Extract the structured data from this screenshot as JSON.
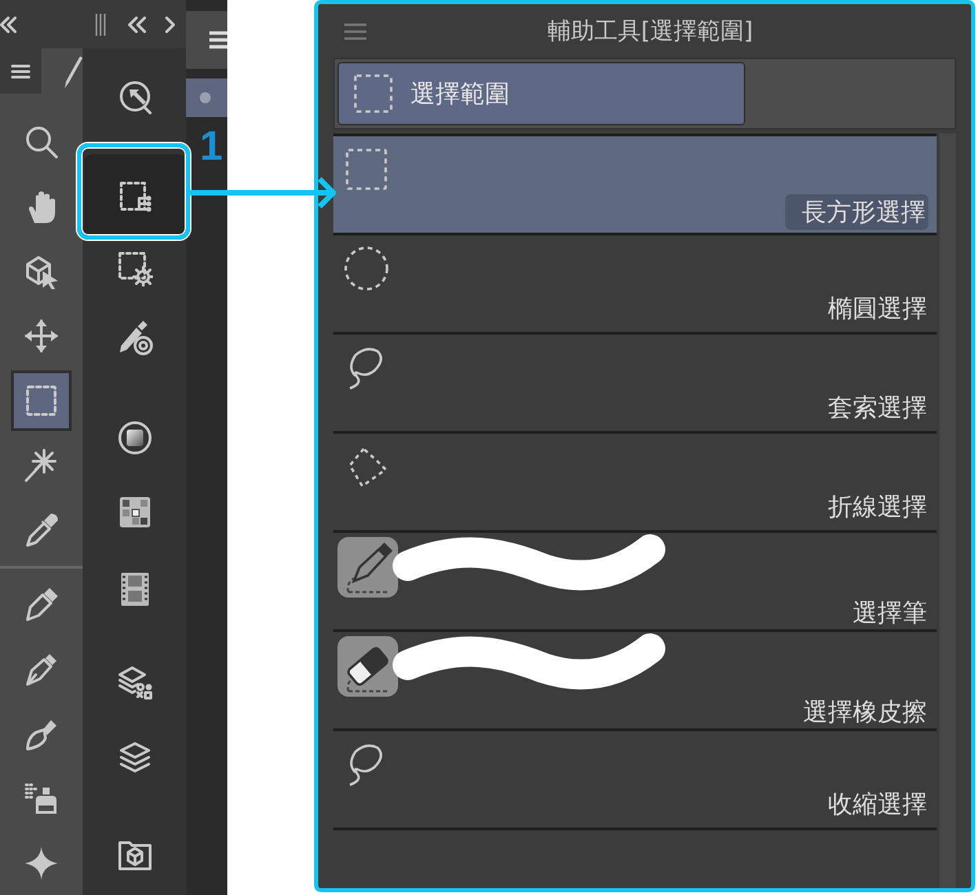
{
  "left_dock": {
    "tool_groups": [
      {
        "tools": [
          {
            "selected": false
          },
          {
            "selected": false
          },
          {
            "selected": false
          },
          {
            "selected": false
          },
          {
            "selected": true
          },
          {
            "selected": false
          },
          {
            "selected": false
          }
        ]
      },
      {
        "tools": [
          {
            "selected": false
          },
          {
            "selected": false
          },
          {
            "selected": false
          },
          {
            "selected": false
          },
          {
            "selected": false
          }
        ]
      }
    ]
  },
  "callout": {
    "number": "1"
  },
  "sub_tool_panel": {
    "title": "輔助工具[選擇範圍]",
    "groups": [
      {
        "label": "選擇範圍",
        "selected": true
      }
    ],
    "sub_tools": [
      {
        "label": "長方形選擇",
        "selected": true,
        "kind": "shape"
      },
      {
        "label": "橢圓選擇",
        "selected": false,
        "kind": "shape"
      },
      {
        "label": "套索選擇",
        "selected": false,
        "kind": "shape"
      },
      {
        "label": "折線選擇",
        "selected": false,
        "kind": "shape"
      },
      {
        "label": "選擇筆",
        "selected": false,
        "kind": "brush"
      },
      {
        "label": "選擇橡皮擦",
        "selected": false,
        "kind": "brush"
      },
      {
        "label": "收縮選擇",
        "selected": false,
        "kind": "shape"
      }
    ]
  }
}
